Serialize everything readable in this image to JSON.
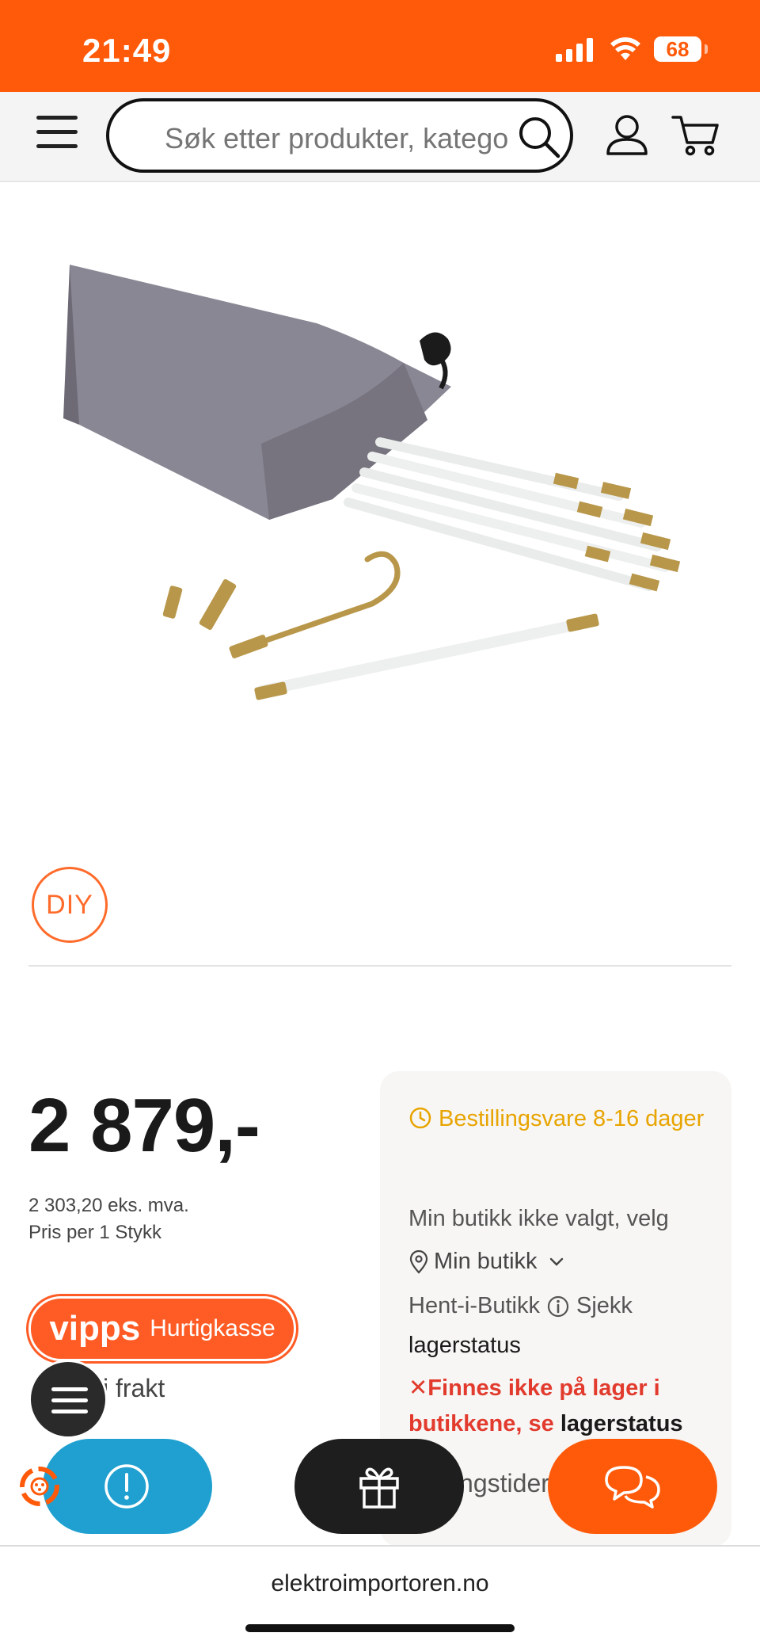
{
  "status_bar": {
    "time": "21:49",
    "battery": "68"
  },
  "header": {
    "search_placeholder": "Søk etter produkter, kategorier"
  },
  "product": {
    "badge": "DIY",
    "price": "2 879,-",
    "price_ex_vat": "2 303,20 eks. mva.",
    "price_per": "Pris per 1 Stykk"
  },
  "vipps": {
    "logo": "vipps",
    "label": "Hurtigkasse"
  },
  "freight_text": "i frakt",
  "stock": {
    "delivery": "Bestillingsvare 8-16 dager",
    "store_not_selected": "Min butikk ikke valgt, velg",
    "my_store": "Min butikk",
    "pickup": "Hent-i-Butikk",
    "check": "Sjekk",
    "lagerstatus": "lagerstatus",
    "not_in_stock": "✕Finnes ikke på lager i butikkene, se",
    "not_in_stock_link": "lagerstatus",
    "opening_hours": "Åpningstider"
  },
  "footer": {
    "url": "elektroimportoren.no"
  },
  "colors": {
    "brand": "#ff5a0a",
    "info_fab": "#1fa0d0",
    "delivery": "#e8a400",
    "error": "#e23b2e"
  }
}
